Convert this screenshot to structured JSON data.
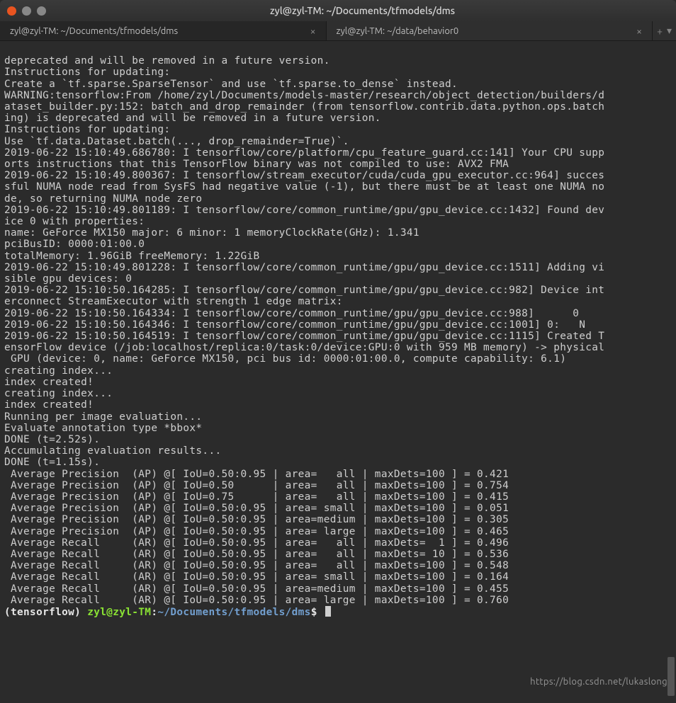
{
  "titlebar": {
    "title": "zyl@zyl-TM: ~/Documents/tfmodels/dms"
  },
  "tabs": [
    {
      "label": "zyl@zyl-TM: ~/Documents/tfmodels/dms",
      "active": true
    },
    {
      "label": "zyl@zyl-TM: ~/data/behavior0",
      "active": false
    }
  ],
  "watermark": "https://blog.csdn.net/lukaslong",
  "terminal": {
    "lines": [
      "deprecated and will be removed in a future version.",
      "Instructions for updating:",
      "Create a `tf.sparse.SparseTensor` and use `tf.sparse.to_dense` instead.",
      "WARNING:tensorflow:From /home/zyl/Documents/models-master/research/object_detection/builders/d",
      "ataset_builder.py:152: batch_and_drop_remainder (from tensorflow.contrib.data.python.ops.batch",
      "ing) is deprecated and will be removed in a future version.",
      "Instructions for updating:",
      "Use `tf.data.Dataset.batch(..., drop_remainder=True)`.",
      "2019-06-22 15:10:49.686780: I tensorflow/core/platform/cpu_feature_guard.cc:141] Your CPU supp",
      "orts instructions that this TensorFlow binary was not compiled to use: AVX2 FMA",
      "2019-06-22 15:10:49.800367: I tensorflow/stream_executor/cuda/cuda_gpu_executor.cc:964] succes",
      "sful NUMA node read from SysFS had negative value (-1), but there must be at least one NUMA no",
      "de, so returning NUMA node zero",
      "2019-06-22 15:10:49.801189: I tensorflow/core/common_runtime/gpu/gpu_device.cc:1432] Found dev",
      "ice 0 with properties:",
      "name: GeForce MX150 major: 6 minor: 1 memoryClockRate(GHz): 1.341",
      "pciBusID: 0000:01:00.0",
      "totalMemory: 1.96GiB freeMemory: 1.22GiB",
      "2019-06-22 15:10:49.801228: I tensorflow/core/common_runtime/gpu/gpu_device.cc:1511] Adding vi",
      "sible gpu devices: 0",
      "2019-06-22 15:10:50.164285: I tensorflow/core/common_runtime/gpu/gpu_device.cc:982] Device int",
      "erconnect StreamExecutor with strength 1 edge matrix:",
      "2019-06-22 15:10:50.164334: I tensorflow/core/common_runtime/gpu/gpu_device.cc:988]      0",
      "2019-06-22 15:10:50.164346: I tensorflow/core/common_runtime/gpu/gpu_device.cc:1001] 0:   N",
      "2019-06-22 15:10:50.164519: I tensorflow/core/common_runtime/gpu/gpu_device.cc:1115] Created T",
      "ensorFlow device (/job:localhost/replica:0/task:0/device:GPU:0 with 959 MB memory) -> physical",
      " GPU (device: 0, name: GeForce MX150, pci bus id: 0000:01:00.0, compute capability: 6.1)",
      "creating index...",
      "index created!",
      "creating index...",
      "index created!",
      "Running per image evaluation...",
      "Evaluate annotation type *bbox*",
      "DONE (t=2.52s).",
      "Accumulating evaluation results...",
      "DONE (t=1.15s).",
      " Average Precision  (AP) @[ IoU=0.50:0.95 | area=   all | maxDets=100 ] = 0.421",
      " Average Precision  (AP) @[ IoU=0.50      | area=   all | maxDets=100 ] = 0.754",
      " Average Precision  (AP) @[ IoU=0.75      | area=   all | maxDets=100 ] = 0.415",
      " Average Precision  (AP) @[ IoU=0.50:0.95 | area= small | maxDets=100 ] = 0.051",
      " Average Precision  (AP) @[ IoU=0.50:0.95 | area=medium | maxDets=100 ] = 0.305",
      " Average Precision  (AP) @[ IoU=0.50:0.95 | area= large | maxDets=100 ] = 0.465",
      " Average Recall     (AR) @[ IoU=0.50:0.95 | area=   all | maxDets=  1 ] = 0.496",
      " Average Recall     (AR) @[ IoU=0.50:0.95 | area=   all | maxDets= 10 ] = 0.536",
      " Average Recall     (AR) @[ IoU=0.50:0.95 | area=   all | maxDets=100 ] = 0.548",
      " Average Recall     (AR) @[ IoU=0.50:0.95 | area= small | maxDets=100 ] = 0.164",
      " Average Recall     (AR) @[ IoU=0.50:0.95 | area=medium | maxDets=100 ] = 0.455",
      " Average Recall     (AR) @[ IoU=0.50:0.95 | area= large | maxDets=100 ] = 0.760"
    ],
    "prompt": {
      "env": "(tensorflow) ",
      "user_host": "zyl@zyl-TM",
      "sep": ":",
      "cwd": "~/Documents/tfmodels/dms",
      "dollar": "$ "
    }
  }
}
